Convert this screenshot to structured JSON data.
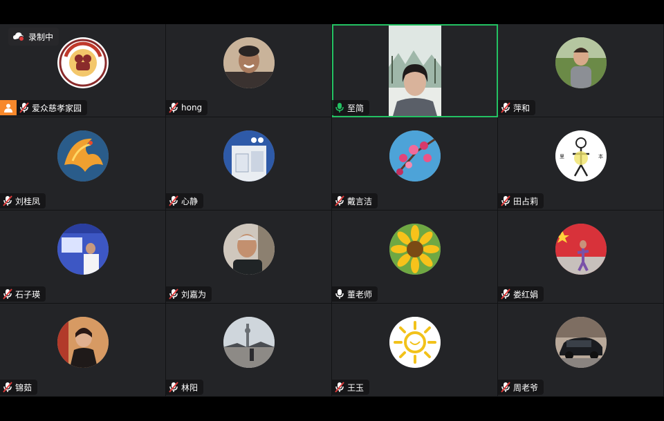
{
  "recording": {
    "label": "录制中"
  },
  "colors": {
    "active_border": "#23c263",
    "host_badge": "#f7882b",
    "mic_on": "#23c263",
    "mic_muted_slash": "#e03b3b"
  },
  "participants": [
    {
      "name": "爱众慈孝家园",
      "mic": "muted",
      "host": true,
      "avatar": "org-logo"
    },
    {
      "name": "hong",
      "mic": "muted",
      "avatar": "photo-man-laughing"
    },
    {
      "name": "至简",
      "mic": "on",
      "active": true,
      "avatar": "video-woman"
    },
    {
      "name": "萍和",
      "mic": "muted",
      "avatar": "photo-woman-garden"
    },
    {
      "name": "刘桂凤",
      "mic": "muted",
      "avatar": "phoenix"
    },
    {
      "name": "心静",
      "mic": "muted",
      "avatar": "room-blue"
    },
    {
      "name": "戴言洁",
      "mic": "muted",
      "avatar": "blossoms"
    },
    {
      "name": "田占莉",
      "mic": "muted",
      "avatar": "calligraphy-figure"
    },
    {
      "name": "石子瑛",
      "mic": "muted",
      "avatar": "photo-stage"
    },
    {
      "name": "刘嘉为",
      "mic": "muted",
      "avatar": "photo-old-man"
    },
    {
      "name": "董老师",
      "mic": "unmuted-white",
      "avatar": "sunflower"
    },
    {
      "name": "娄红娟",
      "mic": "muted",
      "avatar": "flag-dancer"
    },
    {
      "name": "锦茹",
      "mic": "muted",
      "avatar": "photo-woman-red"
    },
    {
      "name": "林阳",
      "mic": "muted",
      "avatar": "photo-tower"
    },
    {
      "name": "王玉",
      "mic": "muted",
      "avatar": "sun-drawing"
    },
    {
      "name": "周老爷",
      "mic": "muted",
      "avatar": "car"
    }
  ]
}
